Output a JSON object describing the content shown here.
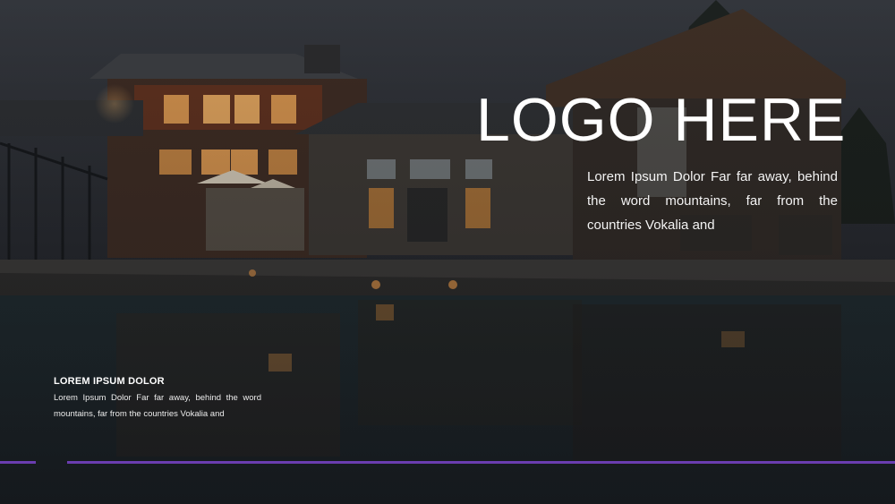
{
  "slide": {
    "logo_text": "LOGO HERE",
    "intro_text": "Lorem Ipsum Dolor Far far away, behind the word mountains, far from the countries Vokalia and",
    "sub_heading": "LOREM IPSUM DOLOR",
    "sub_body": "Lorem Ipsum Dolor Far far away, behind the word mountains, far from the countries Vokalia and"
  },
  "colors": {
    "accent": "#6a3db0",
    "text": "#ffffff",
    "background": "#1b1d22"
  }
}
